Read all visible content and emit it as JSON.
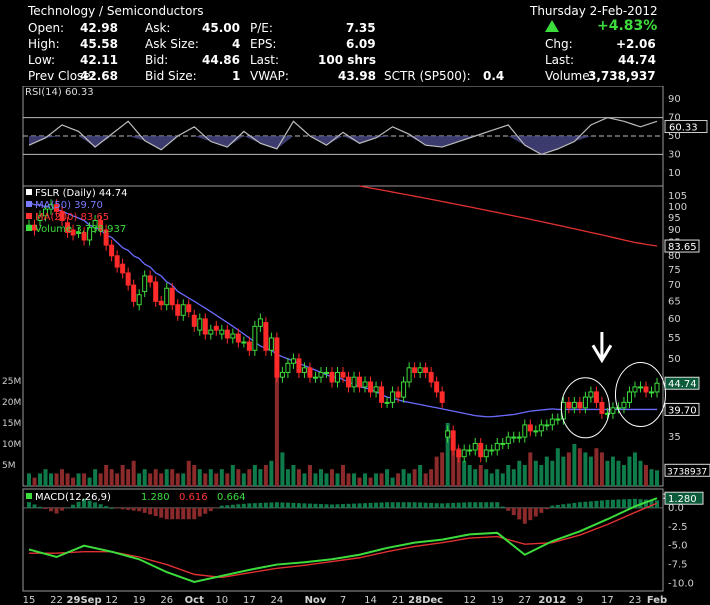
{
  "header": {
    "sector": "Technology / Semiconductors",
    "date": "Thursday  2-Feb-2012",
    "change_pct": "+4.83%",
    "left_stats": [
      {
        "label": "Open:",
        "value": "42.98",
        "label2": "Ask:",
        "value2": "45.00",
        "label3": "P/E:",
        "value3": "7.35"
      },
      {
        "label": "High:",
        "value": "45.58",
        "label2": "Ask Size:",
        "value2": "4",
        "label3": "EPS:",
        "value3": "6.09"
      },
      {
        "label": "Low:",
        "value": "42.11",
        "label2": "Bid:",
        "value2": "44.86",
        "label3": "Last:",
        "value3": "100 shrs"
      },
      {
        "label": "Prev Close:",
        "value": "42.68",
        "label2": "Bid Size:",
        "value2": "1",
        "label3": "VWAP:",
        "value3": "43.98"
      }
    ],
    "sctr_label": "SCTR (SP500):",
    "sctr_value": "0.4",
    "right_stats": [
      {
        "label": "Chg:",
        "value": "+2.06"
      },
      {
        "label": "Last:",
        "value": "44.74"
      },
      {
        "label": "Volume:",
        "value": "3,738,937"
      }
    ],
    "colors": {
      "up": "#3ddc3d",
      "down": "#ff2a2a"
    }
  },
  "chart_data": [
    {
      "type": "line",
      "panel": "rsi",
      "legend": "RSI(14) 60.33",
      "ylim": [
        0,
        100
      ],
      "ticks": [
        "90",
        "70",
        "50",
        "30",
        "10"
      ],
      "tick_values": [
        90,
        70,
        50,
        30,
        10
      ],
      "last_label": "60.33",
      "last_value": 60.33,
      "overbought": 70,
      "oversold": 30,
      "x": [
        0,
        3,
        6,
        9,
        12,
        15,
        18,
        21,
        24,
        27,
        30,
        33,
        36,
        39,
        42,
        45,
        48,
        51,
        54,
        57,
        60,
        63,
        66,
        69,
        72,
        75,
        78,
        81,
        84,
        87,
        90,
        93,
        96,
        99,
        102,
        105,
        108,
        111,
        114
      ],
      "values": [
        40,
        48,
        62,
        55,
        38,
        52,
        66,
        45,
        35,
        50,
        60,
        44,
        38,
        55,
        42,
        36,
        66,
        50,
        40,
        54,
        42,
        48,
        60,
        52,
        40,
        38,
        44,
        50,
        56,
        62,
        40,
        30,
        36,
        44,
        62,
        70,
        66,
        60,
        66
      ]
    },
    {
      "type": "candlestick",
      "panel": "price",
      "legend": [
        "FSLR (Daily) 44.74",
        "MA(50) 39.70",
        "MA(200) 83.65",
        "Volume 3,738,937"
      ],
      "legend_colors": [
        "#ffffff",
        "#7b7bff",
        "#ff3333",
        "#3ddc3d"
      ],
      "ylim": [
        28,
        110
      ],
      "log_scale": true,
      "ticks": [
        "105",
        "100",
        "95",
        "90",
        "85",
        "80",
        "75",
        "70",
        "65",
        "60",
        "55",
        "50",
        "45",
        "40",
        "35",
        "30"
      ],
      "tick_values": [
        105,
        100,
        95,
        90,
        85,
        80,
        75,
        70,
        65,
        60,
        55,
        50,
        45,
        40,
        35,
        30
      ],
      "last_price_label": "44.74",
      "last_price": 44.74,
      "ma50_label": "39.70",
      "ma50_last": 39.7,
      "ma200_label": "83.65",
      "ma200_last": 83.65,
      "volume_ticks": [
        "25M",
        "20M",
        "15M",
        "10M",
        "5M"
      ],
      "volume_tick_values": [
        25,
        20,
        15,
        10,
        5
      ],
      "volume_label": "3738937",
      "volume_last_m": 3.74,
      "x_ticks": [
        "15",
        "22",
        "29Sep",
        "12",
        "19",
        "26",
        "Oct",
        "10",
        "17",
        "24",
        "Nov",
        "7",
        "14",
        "21",
        "28Dec",
        "12",
        "19",
        "27",
        "2012",
        "9",
        "17",
        "23",
        "Feb"
      ],
      "x_tick_index": [
        0,
        5,
        10,
        15,
        20,
        25,
        30,
        35,
        40,
        45,
        52,
        57,
        62,
        67,
        72,
        80,
        85,
        90,
        95,
        100,
        105,
        110,
        114
      ],
      "open": [
        92,
        92,
        94,
        96,
        99,
        101,
        98,
        93,
        90,
        89,
        89,
        86,
        91,
        94,
        90,
        84,
        80,
        77,
        74,
        70,
        64,
        68,
        73,
        71,
        65,
        64,
        69,
        64,
        61,
        64,
        61,
        57,
        60,
        56,
        58,
        56,
        57,
        55,
        56,
        54,
        54,
        52,
        58,
        59,
        52,
        55,
        46,
        47,
        49,
        50,
        47,
        48,
        46,
        46,
        47,
        47,
        45,
        47,
        46,
        44,
        46,
        44,
        45,
        43,
        44,
        41,
        41,
        43,
        42,
        45,
        48,
        47,
        48,
        47,
        45,
        43,
        35,
        36,
        33,
        32,
        33,
        33,
        34,
        32,
        33,
        33,
        34,
        34,
        35,
        35,
        35,
        37,
        36,
        36,
        37,
        37,
        38,
        38,
        41,
        40,
        41,
        40,
        42,
        43,
        41,
        39,
        39,
        40,
        40,
        41,
        43,
        44,
        44,
        43,
        43
      ],
      "close": [
        92,
        90,
        96,
        99,
        101,
        98,
        94,
        89,
        88,
        89,
        86,
        91,
        94,
        90,
        84,
        80,
        76,
        74,
        70,
        65,
        67,
        73,
        71,
        65,
        64,
        69,
        64,
        61,
        64,
        62,
        58,
        60,
        56,
        57,
        57,
        57,
        55,
        56,
        54,
        54,
        52,
        58,
        60,
        52,
        55,
        46,
        47,
        49,
        50,
        47,
        48,
        46,
        46,
        47,
        47,
        45,
        47,
        46,
        44,
        46,
        44,
        45,
        43,
        44,
        41,
        41,
        43,
        42,
        45,
        48,
        47,
        48,
        47,
        45,
        43,
        41,
        36,
        33,
        32,
        33,
        33,
        34,
        32,
        33,
        33,
        34,
        34,
        35,
        35,
        35,
        37,
        36,
        36,
        37,
        37,
        38,
        38,
        41,
        40,
        41,
        40,
        42,
        43,
        41,
        39,
        39,
        40,
        40,
        41,
        43,
        44,
        44,
        43,
        43,
        44.74
      ],
      "ma50": [
        102,
        101,
        101,
        100,
        100,
        99,
        98,
        97,
        96,
        95,
        94,
        92,
        91,
        90,
        88,
        87,
        85,
        83,
        82,
        80,
        79,
        77,
        76,
        74,
        73,
        71,
        70,
        68,
        67,
        66,
        65,
        64,
        63,
        62,
        61,
        60,
        59,
        58,
        57,
        56,
        55,
        54,
        53,
        52.5,
        52,
        51,
        50.5,
        50,
        49.5,
        49,
        48.5,
        48,
        47.5,
        47,
        46.5,
        46,
        46,
        45.5,
        45,
        44.5,
        44,
        43.8,
        43.5,
        43,
        42.5,
        42,
        41.8,
        41.5,
        41.2,
        41,
        40.8,
        40.6,
        40.4,
        40.2,
        40,
        39.8,
        39.6,
        39.4,
        39.2,
        39,
        38.8,
        38.6,
        38.5,
        38.4,
        38.4,
        38.5,
        38.6,
        38.7,
        38.8,
        39,
        39.2,
        39.4,
        39.5,
        39.6,
        39.7,
        39.8,
        39.7,
        39.7,
        39.7,
        39.7,
        39.7,
        39.7,
        39.7,
        39.7,
        39.7,
        39.7,
        39.7,
        39.7,
        39.7,
        39.7,
        39.7,
        39.7,
        39.7,
        39.7,
        39.7
      ],
      "ma200": [
        null,
        null,
        null,
        null,
        null,
        null,
        null,
        null,
        null,
        null,
        null,
        null,
        null,
        null,
        null,
        null,
        null,
        null,
        null,
        null,
        null,
        null,
        null,
        null,
        null,
        null,
        null,
        null,
        null,
        null,
        null,
        null,
        null,
        null,
        null,
        null,
        null,
        null,
        null,
        null,
        null,
        null,
        null,
        null,
        null,
        null,
        null,
        null,
        null,
        null,
        null,
        null,
        null,
        null,
        null,
        null,
        null,
        null,
        null,
        null,
        110,
        109.5,
        109,
        108.5,
        108,
        107.5,
        107,
        106.5,
        106,
        105.5,
        105,
        104.5,
        104,
        103.5,
        103,
        102.5,
        102,
        101.5,
        101,
        100.5,
        100,
        99.5,
        99,
        98.5,
        98,
        97.5,
        97,
        96.5,
        96,
        95.5,
        95,
        94.5,
        94,
        93.5,
        93,
        92.5,
        92,
        91.5,
        91,
        90.5,
        90,
        89.5,
        89,
        88.5,
        88,
        87.5,
        87,
        86.5,
        86,
        85.5,
        85,
        84.7,
        84.3,
        84,
        83.65
      ],
      "volume_m": [
        3,
        2,
        3,
        4,
        3,
        3,
        4,
        3,
        2,
        3,
        3,
        2,
        4,
        3,
        5,
        4,
        3,
        5,
        4,
        6,
        3,
        4,
        3,
        4,
        3,
        4,
        4,
        3,
        3,
        6,
        5,
        4,
        3,
        4,
        3,
        4,
        3,
        5,
        4,
        3,
        4,
        5,
        4,
        5,
        6,
        26,
        8,
        4,
        5,
        4,
        3,
        5,
        3,
        4,
        3,
        4,
        3,
        5,
        3,
        3,
        2,
        3,
        2,
        3,
        3,
        4,
        2,
        3,
        4,
        3,
        4,
        5,
        3,
        4,
        7,
        8,
        15,
        12,
        9,
        6,
        5,
        4,
        5,
        4,
        3,
        4,
        3,
        5,
        4,
        6,
        5,
        8,
        6,
        5,
        7,
        6,
        9,
        7,
        8,
        10,
        9,
        8,
        7,
        9,
        8,
        6,
        7,
        6,
        5,
        7,
        8,
        6,
        5,
        4,
        3.74
      ]
    },
    {
      "type": "line",
      "panel": "macd",
      "legend_prefix": "MACD(12,26,9)",
      "legend_values": [
        "1.280",
        "0.616",
        "0.664"
      ],
      "legend_colors": [
        "#3ddc3d",
        "#ff3333",
        "#3ddc3d"
      ],
      "ylim": [
        -11,
        2.5
      ],
      "ticks": [
        "0.0",
        "-2.5",
        "-5.0",
        "-7.5",
        "-10.0"
      ],
      "tick_values": [
        0,
        -2.5,
        -5,
        -7.5,
        -10
      ],
      "last_label": "1.280",
      "last_value": 1.28,
      "x": [
        0,
        5,
        10,
        15,
        20,
        25,
        30,
        35,
        40,
        45,
        50,
        55,
        60,
        65,
        70,
        75,
        80,
        85,
        90,
        95,
        100,
        105,
        110,
        114
      ],
      "macd": [
        -5.5,
        -6.5,
        -5,
        -5.8,
        -6.8,
        -8.5,
        -9.8,
        -9,
        -8.2,
        -7.5,
        -7.2,
        -6.8,
        -6.2,
        -5.3,
        -4.6,
        -4.2,
        -3.5,
        -3.3,
        -6.2,
        -4.4,
        -3.1,
        -1.5,
        0.2,
        1.28
      ],
      "signal": [
        -6,
        -6,
        -5.8,
        -5.8,
        -6.5,
        -7.5,
        -8.8,
        -9.2,
        -8.6,
        -8,
        -7.6,
        -7.1,
        -6.6,
        -5.8,
        -5.1,
        -4.6,
        -4,
        -3.8,
        -4.8,
        -4.6,
        -3.6,
        -2.2,
        -0.6,
        0.616
      ],
      "histogram": [
        0.5,
        -0.5,
        0.8,
        0,
        -0.3,
        -1,
        -1,
        0.2,
        0.4,
        0.5,
        0.4,
        0.3,
        0.4,
        0.5,
        0.5,
        0.4,
        0.5,
        0.5,
        -1.4,
        0.2,
        0.5,
        0.7,
        0.8,
        0.664
      ]
    }
  ]
}
